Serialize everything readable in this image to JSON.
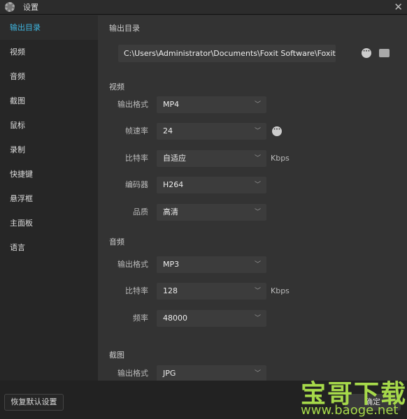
{
  "window": {
    "title": "设置",
    "icon": "gear-icon",
    "close_icon": "close-icon"
  },
  "sidebar": {
    "items": [
      {
        "label": "输出目录",
        "active": true
      },
      {
        "label": "视频"
      },
      {
        "label": "音频"
      },
      {
        "label": "截图"
      },
      {
        "label": "鼠标"
      },
      {
        "label": "录制"
      },
      {
        "label": "快捷键"
      },
      {
        "label": "悬浮框"
      },
      {
        "label": "主面板"
      },
      {
        "label": "语言"
      }
    ]
  },
  "output": {
    "heading": "输出目录",
    "path": "C:\\Users\\Administrator\\Documents\\Foxit Software\\FoxitREC\\"
  },
  "video": {
    "heading": "视频",
    "format": {
      "label": "输出格式",
      "value": "MP4"
    },
    "fps": {
      "label": "帧速率",
      "value": "24"
    },
    "bitrate": {
      "label": "比特率",
      "value": "自适应",
      "unit": "Kbps"
    },
    "encoder": {
      "label": "编码器",
      "value": "H264"
    },
    "quality": {
      "label": "品质",
      "value": "高清"
    }
  },
  "audio": {
    "heading": "音频",
    "format": {
      "label": "输出格式",
      "value": "MP3"
    },
    "bitrate": {
      "label": "比特率",
      "value": "128",
      "unit": "Kbps"
    },
    "frequency": {
      "label": "频率",
      "value": "48000"
    }
  },
  "screenshot": {
    "heading": "截图",
    "format": {
      "label": "输出格式",
      "value": "JPG"
    }
  },
  "footer": {
    "reset_label": "恢复默认设置",
    "ok_label": "确定"
  },
  "watermark": {
    "title": "宝哥下载",
    "url": "www.baoge.net",
    "color": "#a6d94a"
  },
  "colors": {
    "accent": "#3fb6e0"
  }
}
